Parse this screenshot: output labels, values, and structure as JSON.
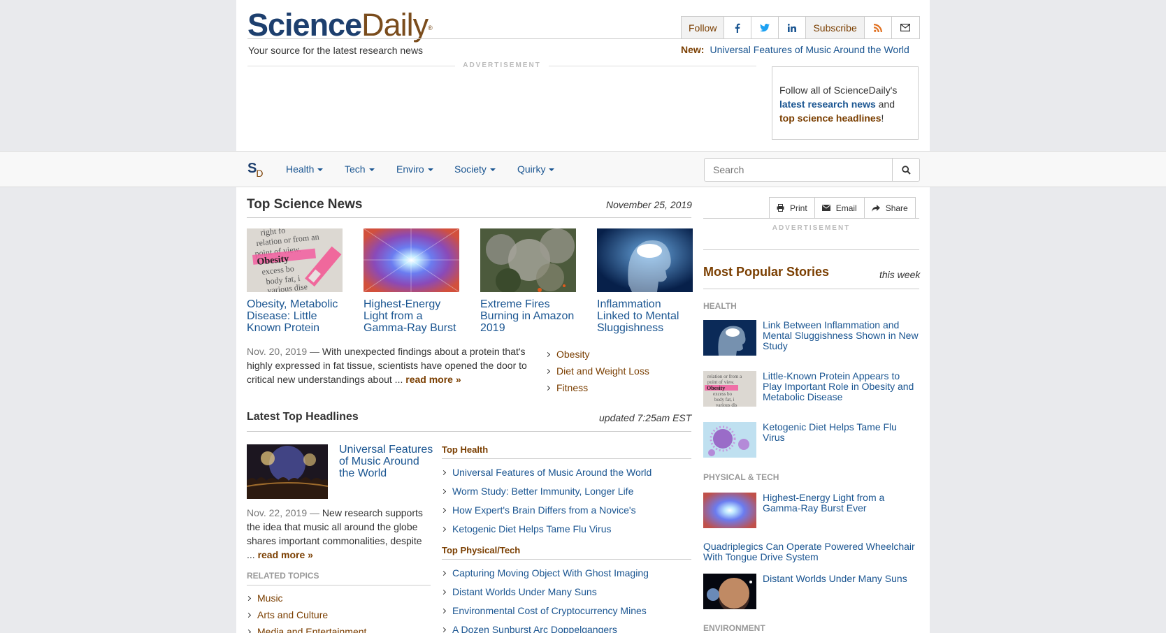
{
  "header": {
    "logo_part1": "Science",
    "logo_part2": "Daily",
    "logo_mark": "®",
    "tagline": "Your source for the latest research news",
    "follow_label": "Follow",
    "subscribe_label": "Subscribe",
    "new_label": "New:",
    "new_link": "Universal Features of Music Around the World",
    "ad_label": "ADVERTISEMENT",
    "follow_box": {
      "text1": "Follow all of ScienceDaily's",
      "link1": "latest research news",
      "text2": "and",
      "link2": "top science headlines",
      "text3": "!"
    }
  },
  "nav": {
    "logo_s": "S",
    "logo_d": "D",
    "items": [
      "Health",
      "Tech",
      "Enviro",
      "Society",
      "Quirky"
    ],
    "search_placeholder": "Search"
  },
  "top_news": {
    "title": "Top Science News",
    "date": "November 25, 2019",
    "stories": [
      {
        "title": "Obesity, Metabolic Disease: Little Known Protein"
      },
      {
        "title": "Highest-Energy Light from a Gamma-Ray Burst"
      },
      {
        "title": "Extreme Fires Burning in Amazon 2019"
      },
      {
        "title": "Inflammation Linked to Mental Sluggishness"
      }
    ],
    "summary_date": "Nov. 20, 2019",
    "summary_sep": " — ",
    "summary_text": "With unexpected findings about a protein that's highly expressed in fat tissue, scientists have opened the door to critical new understandings about ...",
    "read_more": "read more »",
    "topics": [
      "Obesity",
      "Diet and Weight Loss",
      "Fitness"
    ]
  },
  "latest": {
    "title": "Latest Top Headlines",
    "updated": "updated 7:25am EST",
    "feature_title": "Universal Features of Music Around the World",
    "feature_date": "Nov. 22, 2019",
    "feature_sep": " — ",
    "feature_text": "New research supports the idea that music all around the globe shares important commonalities, despite ...",
    "read_more": "read more »",
    "related_label": "RELATED TOPICS",
    "related": [
      "Music",
      "Arts and Culture",
      "Media and Entertainment"
    ],
    "top_health_label": "Top Health",
    "top_health": [
      "Universal Features of Music Around the World",
      "Worm Study: Better Immunity, Longer Life",
      "How Expert's Brain Differs from a Novice's",
      "Ketogenic Diet Helps Tame Flu Virus"
    ],
    "top_phys_label": "Top Physical/Tech",
    "top_phys": [
      "Capturing Moving Object With Ghost Imaging",
      "Distant Worlds Under Many Suns",
      "Environmental Cost of Cryptocurrency Mines",
      "A Dozen Sunburst Arc Doppelgangers"
    ]
  },
  "sidebar": {
    "print": "Print",
    "email": "Email",
    "share": "Share",
    "ad_label": "ADVERTISEMENT",
    "popular_title": "Most Popular Stories",
    "popular_period": "this week",
    "health_label": "HEALTH",
    "health": [
      "Link Between Inflammation and Mental Sluggishness Shown in New Study",
      "Little-Known Protein Appears to Play Important Role in Obesity and Metabolic Disease",
      "Ketogenic Diet Helps Tame Flu Virus"
    ],
    "phys_label": "PHYSICAL & TECH",
    "phys": [
      "Highest-Energy Light from a Gamma-Ray Burst Ever",
      "Quadriplegics Can Operate Powered Wheelchair With Tongue Drive System",
      "Distant Worlds Under Many Suns"
    ],
    "env_label": "ENVIRONMENT"
  }
}
